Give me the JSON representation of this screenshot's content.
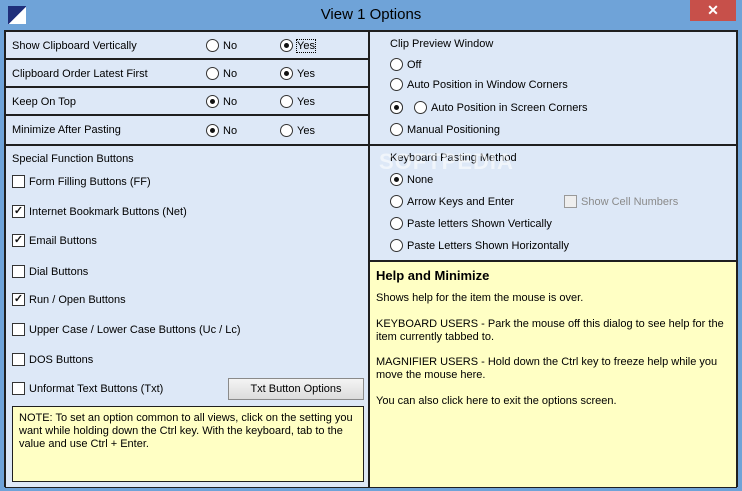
{
  "window": {
    "title": "View 1 Options",
    "close_label": "✕"
  },
  "rows": [
    {
      "label": "Show Clipboard Vertically",
      "no": "No",
      "yes": "Yes",
      "selected": "yes"
    },
    {
      "label": "Clipboard Order Latest First",
      "no": "No",
      "yes": "Yes",
      "selected": "yes"
    },
    {
      "label": "Keep On Top",
      "no": "No",
      "yes": "Yes",
      "selected": "no"
    },
    {
      "label": "Minimize After Pasting",
      "no": "No",
      "yes": "Yes",
      "selected": "no"
    }
  ],
  "clip_preview": {
    "heading": "Clip Preview Window",
    "options": [
      "Off",
      "Auto Position in Window Corners",
      "Auto Position in Screen Corners",
      "Manual Positioning"
    ]
  },
  "special_buttons": {
    "heading": "Special Function Buttons",
    "items": [
      {
        "label": "Form Filling Buttons (FF)",
        "checked": false
      },
      {
        "label": "Internet Bookmark Buttons (Net)",
        "checked": true
      },
      {
        "label": "Email Buttons",
        "checked": true
      },
      {
        "label": "Dial Buttons",
        "checked": false
      },
      {
        "label": "Run / Open Buttons",
        "checked": true
      },
      {
        "label": "Upper Case / Lower Case Buttons (Uc / Lc)",
        "checked": false
      },
      {
        "label": "DOS Buttons",
        "checked": false
      },
      {
        "label": "Unformat Text Buttons (Txt)",
        "checked": false
      }
    ],
    "txt_button_label": "Txt Button Options"
  },
  "keyboard_pasting": {
    "heading": "Keyboard Pasting Method",
    "options": [
      "None",
      "Arrow Keys and Enter",
      "Paste letters Shown Vertically",
      "Paste Letters Shown Horizontally"
    ],
    "show_cell_numbers": "Show Cell Numbers"
  },
  "note": {
    "text": "NOTE:  To set an option common to all views, click on the setting you want while holding down the Ctrl key. With the keyboard, tab to the value and use Ctrl + Enter."
  },
  "help": {
    "title": "Help and Minimize",
    "p1": "Shows help for the item the mouse is over.",
    "p2": "KEYBOARD USERS - Park the mouse off this dialog to see help for the item currently tabbed to.",
    "p3": "MAGNIFIER USERS - Hold down the Ctrl key to freeze help while you move the mouse here.",
    "p4": "You can also click here to exit the options screen."
  },
  "watermark": "SOFTPEDIA",
  "colors": {
    "title_bar": "#6fa3d8",
    "panel": "#dde8f7",
    "note_bg": "#ffffc4",
    "close": "#c7504a"
  }
}
